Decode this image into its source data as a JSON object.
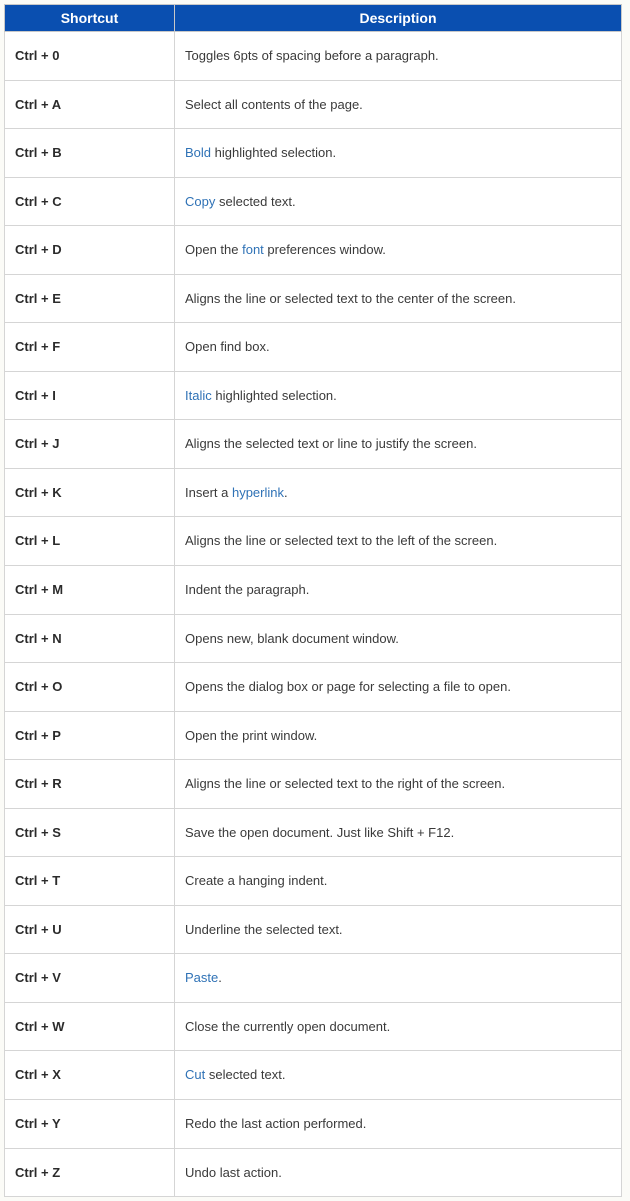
{
  "headers": {
    "shortcut": "Shortcut",
    "description": "Description"
  },
  "rows": [
    {
      "shortcut": "Ctrl + 0",
      "segs": [
        {
          "t": "Toggles 6pts of spacing before a paragraph."
        }
      ]
    },
    {
      "shortcut": "Ctrl + A",
      "segs": [
        {
          "t": "Select all contents of the page."
        }
      ]
    },
    {
      "shortcut": "Ctrl + B",
      "segs": [
        {
          "t": "Bold",
          "link": true
        },
        {
          "t": " highlighted selection."
        }
      ]
    },
    {
      "shortcut": "Ctrl + C",
      "segs": [
        {
          "t": "Copy",
          "link": true
        },
        {
          "t": " selected text."
        }
      ]
    },
    {
      "shortcut": "Ctrl + D",
      "segs": [
        {
          "t": "Open the "
        },
        {
          "t": "font",
          "link": true
        },
        {
          "t": " preferences window."
        }
      ]
    },
    {
      "shortcut": "Ctrl + E",
      "segs": [
        {
          "t": "Aligns the line or selected text to the center of the screen."
        }
      ]
    },
    {
      "shortcut": "Ctrl + F",
      "segs": [
        {
          "t": "Open find box."
        }
      ]
    },
    {
      "shortcut": "Ctrl + I",
      "segs": [
        {
          "t": "Italic",
          "link": true
        },
        {
          "t": " highlighted selection."
        }
      ]
    },
    {
      "shortcut": "Ctrl + J",
      "segs": [
        {
          "t": "Aligns the selected text or line to justify the screen."
        }
      ]
    },
    {
      "shortcut": "Ctrl + K",
      "segs": [
        {
          "t": "Insert a "
        },
        {
          "t": "hyperlink",
          "link": true
        },
        {
          "t": "."
        }
      ]
    },
    {
      "shortcut": "Ctrl + L",
      "segs": [
        {
          "t": "Aligns the line or selected text to the left of the screen."
        }
      ]
    },
    {
      "shortcut": "Ctrl + M",
      "segs": [
        {
          "t": "Indent the paragraph."
        }
      ]
    },
    {
      "shortcut": "Ctrl + N",
      "segs": [
        {
          "t": "Opens new, blank document window."
        }
      ]
    },
    {
      "shortcut": "Ctrl + O",
      "segs": [
        {
          "t": "Opens the dialog box or page for selecting a file to open."
        }
      ]
    },
    {
      "shortcut": "Ctrl + P",
      "segs": [
        {
          "t": "Open the print window."
        }
      ]
    },
    {
      "shortcut": "Ctrl + R",
      "segs": [
        {
          "t": "Aligns the line or selected text to the right of the screen."
        }
      ]
    },
    {
      "shortcut": "Ctrl + S",
      "segs": [
        {
          "t": "Save the open document. Just like Shift + F12."
        }
      ]
    },
    {
      "shortcut": "Ctrl + T",
      "segs": [
        {
          "t": "Create a hanging indent."
        }
      ]
    },
    {
      "shortcut": "Ctrl + U",
      "segs": [
        {
          "t": "Underline the selected text."
        }
      ]
    },
    {
      "shortcut": "Ctrl + V",
      "segs": [
        {
          "t": "Paste",
          "link": true
        },
        {
          "t": "."
        }
      ]
    },
    {
      "shortcut": "Ctrl + W",
      "segs": [
        {
          "t": "Close the currently open document."
        }
      ]
    },
    {
      "shortcut": "Ctrl + X",
      "segs": [
        {
          "t": "Cut",
          "link": true
        },
        {
          "t": " selected text."
        }
      ]
    },
    {
      "shortcut": "Ctrl + Y",
      "segs": [
        {
          "t": "Redo the last action performed."
        }
      ]
    },
    {
      "shortcut": "Ctrl + Z",
      "segs": [
        {
          "t": "Undo last action."
        }
      ]
    }
  ]
}
